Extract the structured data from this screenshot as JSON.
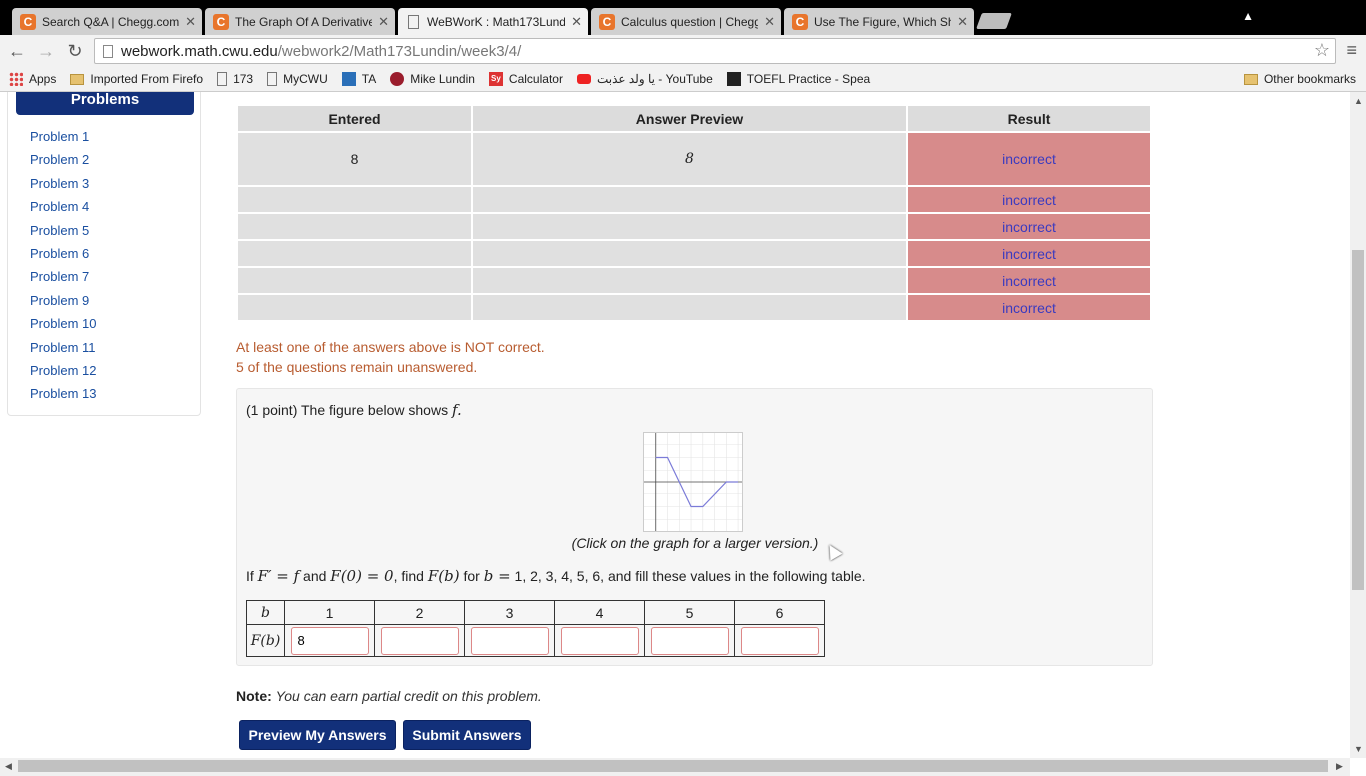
{
  "tabs": [
    {
      "title": "Search Q&A | Chegg.com",
      "icon": "chegg-icon"
    },
    {
      "title": "The Graph Of A Derivative",
      "icon": "chegg-icon"
    },
    {
      "title": "WeBWorK : Math173Lundin",
      "icon": "page-icon"
    },
    {
      "title": "Calculus question | Chegg",
      "icon": "chegg-icon"
    },
    {
      "title": "Use The Figure, Which Sh",
      "icon": "chegg-icon"
    }
  ],
  "url": {
    "domain": "webwork.math.cwu.edu",
    "path": "/webwork2/Math173Lundin/week3/4/"
  },
  "bookmarks": [
    {
      "label": "Apps",
      "icon": "apps-icon"
    },
    {
      "label": "Imported From Firefo",
      "icon": "folder-icon"
    },
    {
      "label": "173",
      "icon": "page-icon"
    },
    {
      "label": "MyCWU",
      "icon": "page-icon"
    },
    {
      "label": "TA",
      "icon": "ta-icon"
    },
    {
      "label": "Mike Lundin",
      "icon": "ml-icon"
    },
    {
      "label": "Calculator",
      "icon": "sy-icon"
    },
    {
      "label": "يا ولد عذبت - YouTube",
      "icon": "youtube-icon"
    },
    {
      "label": "TOEFL Practice - Spea",
      "icon": "toefl-icon"
    }
  ],
  "other_bookmarks": "Other bookmarks",
  "sidebar": {
    "title": "Problems",
    "items": [
      "Problem 1",
      "Problem 2",
      "Problem 3",
      "Problem 4",
      "Problem 5",
      "Problem 6",
      "Problem 7",
      "Problem 9",
      "Problem 10",
      "Problem 11",
      "Problem 12",
      "Problem 13"
    ]
  },
  "results": {
    "headers": [
      "Entered",
      "Answer Preview",
      "Result"
    ],
    "rows": [
      {
        "entered": "8",
        "preview": "8",
        "result": "incorrect"
      },
      {
        "entered": "",
        "preview": "",
        "result": "incorrect"
      },
      {
        "entered": "",
        "preview": "",
        "result": "incorrect"
      },
      {
        "entered": "",
        "preview": "",
        "result": "incorrect"
      },
      {
        "entered": "",
        "preview": "",
        "result": "incorrect"
      },
      {
        "entered": "",
        "preview": "",
        "result": "incorrect"
      }
    ]
  },
  "messages": {
    "not_correct": "At least one of the answers above is NOT correct.",
    "unanswered": "5 of the questions remain unanswered."
  },
  "problem": {
    "intro": "(1 point) The figure below shows",
    "intro_math": "f.",
    "caption": "(Click on the graph for a larger version.)",
    "instr_1": "If",
    "math_1": "F′ = f",
    "instr_2": "and",
    "math_2": "F(0) = 0",
    "instr_3": ", find",
    "math_3": "F(b)",
    "instr_4": "for",
    "math_4": "b =",
    "instr_5": "1, 2, 3, 4, 5, 6, and fill these values in the following table.",
    "table_b_label": "b",
    "table_fb_label": "F(b)",
    "b_values": [
      "1",
      "2",
      "3",
      "4",
      "5",
      "6"
    ],
    "inputs": [
      "8",
      "",
      "",
      "",
      "",
      ""
    ]
  },
  "note": {
    "label": "Note:",
    "text": "You can earn partial credit on this problem."
  },
  "buttons": {
    "preview": "Preview My Answers",
    "submit": "Submit Answers"
  }
}
